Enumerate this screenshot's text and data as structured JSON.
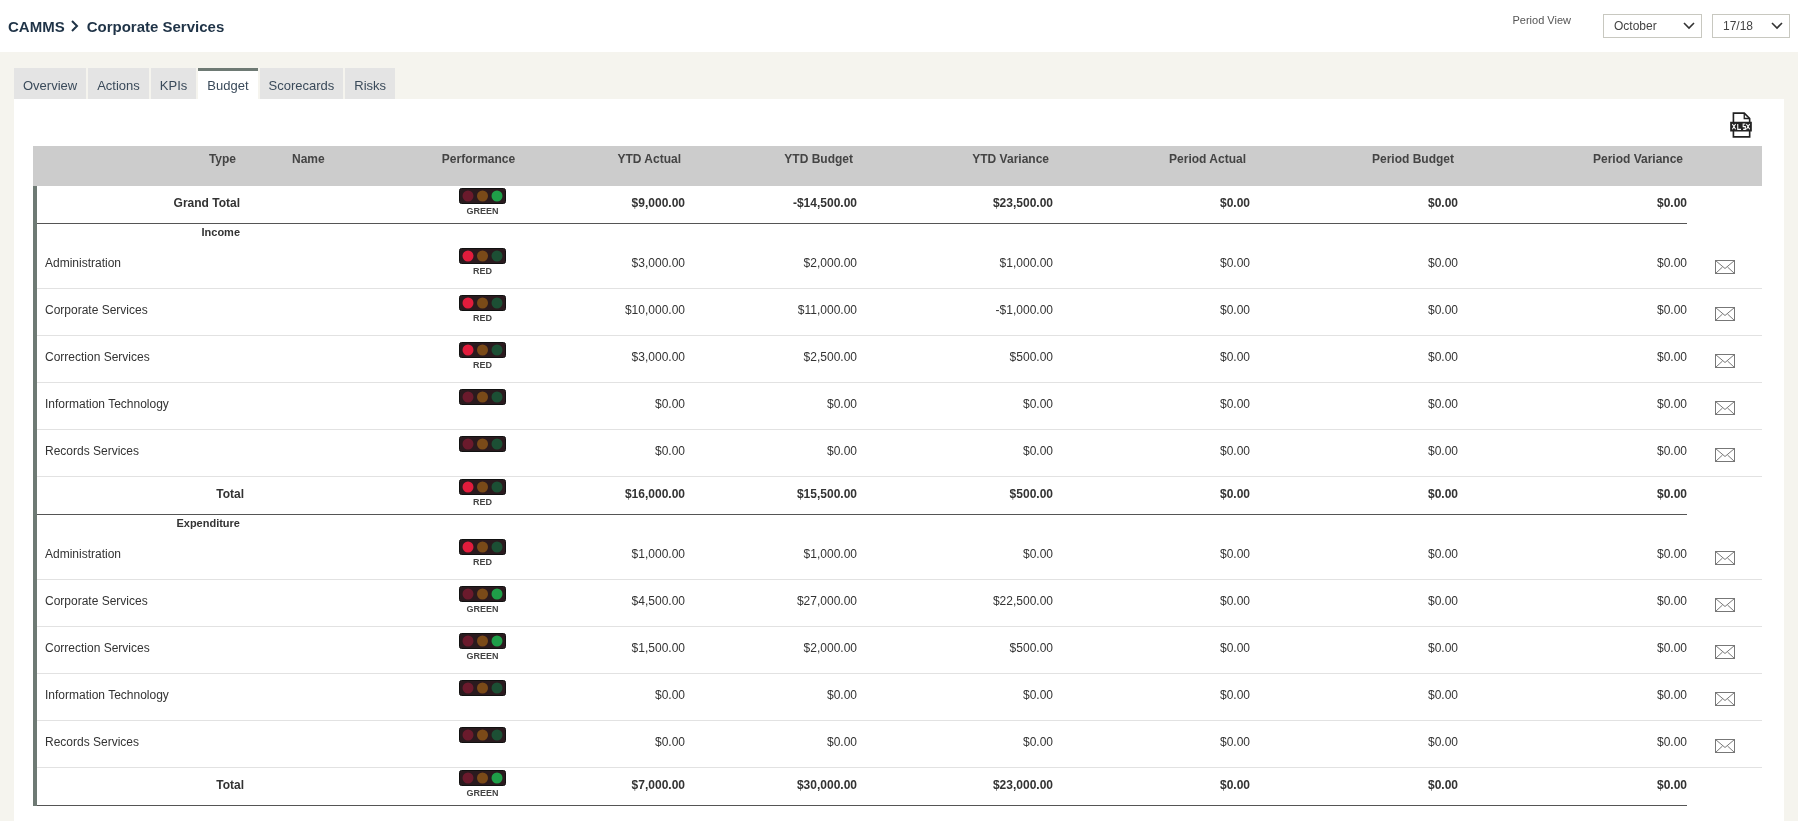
{
  "breadcrumb": {
    "root": "CAMMS",
    "current": "Corporate Services"
  },
  "period_view": {
    "label": "Period View",
    "month": "October",
    "year": "17/18"
  },
  "tabs": [
    {
      "label": "Overview",
      "selected": false
    },
    {
      "label": "Actions",
      "selected": false
    },
    {
      "label": "KPIs",
      "selected": false
    },
    {
      "label": "Budget",
      "selected": true
    },
    {
      "label": "Scorecards",
      "selected": false
    },
    {
      "label": "Risks",
      "selected": false
    }
  ],
  "table": {
    "columns": [
      "Type",
      "Name",
      "Performance",
      "YTD Actual",
      "YTD Budget",
      "YTD Variance",
      "Period Actual",
      "Period Budget",
      "Period Variance"
    ],
    "rows": [
      {
        "kind": "grand_total",
        "label": "Grand Total",
        "red_lit": false,
        "green_lit": true,
        "status_label": "GREEN",
        "values": [
          "$9,000.00",
          "-$14,500.00",
          "$23,500.00",
          "$0.00",
          "$0.00",
          "$0.00"
        ]
      },
      {
        "kind": "section",
        "label": "Income"
      },
      {
        "kind": "item",
        "label": "Administration",
        "red_lit": true,
        "green_lit": false,
        "status_label": "RED",
        "values": [
          "$3,000.00",
          "$2,000.00",
          "$1,000.00",
          "$0.00",
          "$0.00",
          "$0.00"
        ]
      },
      {
        "kind": "item",
        "label": "Corporate Services",
        "red_lit": true,
        "green_lit": false,
        "status_label": "RED",
        "values": [
          "$10,000.00",
          "$11,000.00",
          "-$1,000.00",
          "$0.00",
          "$0.00",
          "$0.00"
        ]
      },
      {
        "kind": "item",
        "label": "Correction Services",
        "red_lit": true,
        "green_lit": false,
        "status_label": "RED",
        "values": [
          "$3,000.00",
          "$2,500.00",
          "$500.00",
          "$0.00",
          "$0.00",
          "$0.00"
        ]
      },
      {
        "kind": "item",
        "label": "Information Technology",
        "red_lit": false,
        "green_lit": false,
        "values": [
          "$0.00",
          "$0.00",
          "$0.00",
          "$0.00",
          "$0.00",
          "$0.00"
        ]
      },
      {
        "kind": "item",
        "label": "Records Services",
        "red_lit": false,
        "green_lit": false,
        "values": [
          "$0.00",
          "$0.00",
          "$0.00",
          "$0.00",
          "$0.00",
          "$0.00"
        ]
      },
      {
        "kind": "total",
        "label": "Total",
        "red_lit": true,
        "green_lit": false,
        "status_label": "RED",
        "values": [
          "$16,000.00",
          "$15,500.00",
          "$500.00",
          "$0.00",
          "$0.00",
          "$0.00"
        ]
      },
      {
        "kind": "section",
        "label": "Expenditure"
      },
      {
        "kind": "item",
        "label": "Administration",
        "red_lit": true,
        "green_lit": false,
        "status_label": "RED",
        "values": [
          "$1,000.00",
          "$1,000.00",
          "$0.00",
          "$0.00",
          "$0.00",
          "$0.00"
        ]
      },
      {
        "kind": "item",
        "label": "Corporate Services",
        "red_lit": false,
        "green_lit": true,
        "status_label": "GREEN",
        "values": [
          "$4,500.00",
          "$27,000.00",
          "$22,500.00",
          "$0.00",
          "$0.00",
          "$0.00"
        ]
      },
      {
        "kind": "item",
        "label": "Correction Services",
        "red_lit": false,
        "green_lit": true,
        "status_label": "GREEN",
        "values": [
          "$1,500.00",
          "$2,000.00",
          "$500.00",
          "$0.00",
          "$0.00",
          "$0.00"
        ]
      },
      {
        "kind": "item",
        "label": "Information Technology",
        "red_lit": false,
        "green_lit": false,
        "values": [
          "$0.00",
          "$0.00",
          "$0.00",
          "$0.00",
          "$0.00",
          "$0.00"
        ]
      },
      {
        "kind": "item",
        "label": "Records Services",
        "red_lit": false,
        "green_lit": false,
        "values": [
          "$0.00",
          "$0.00",
          "$0.00",
          "$0.00",
          "$0.00",
          "$0.00"
        ]
      },
      {
        "kind": "total",
        "label": "Total",
        "red_lit": false,
        "green_lit": true,
        "status_label": "GREEN",
        "values": [
          "$7,000.00",
          "$30,000.00",
          "$23,000.00",
          "$0.00",
          "$0.00",
          "$0.00"
        ]
      }
    ]
  }
}
